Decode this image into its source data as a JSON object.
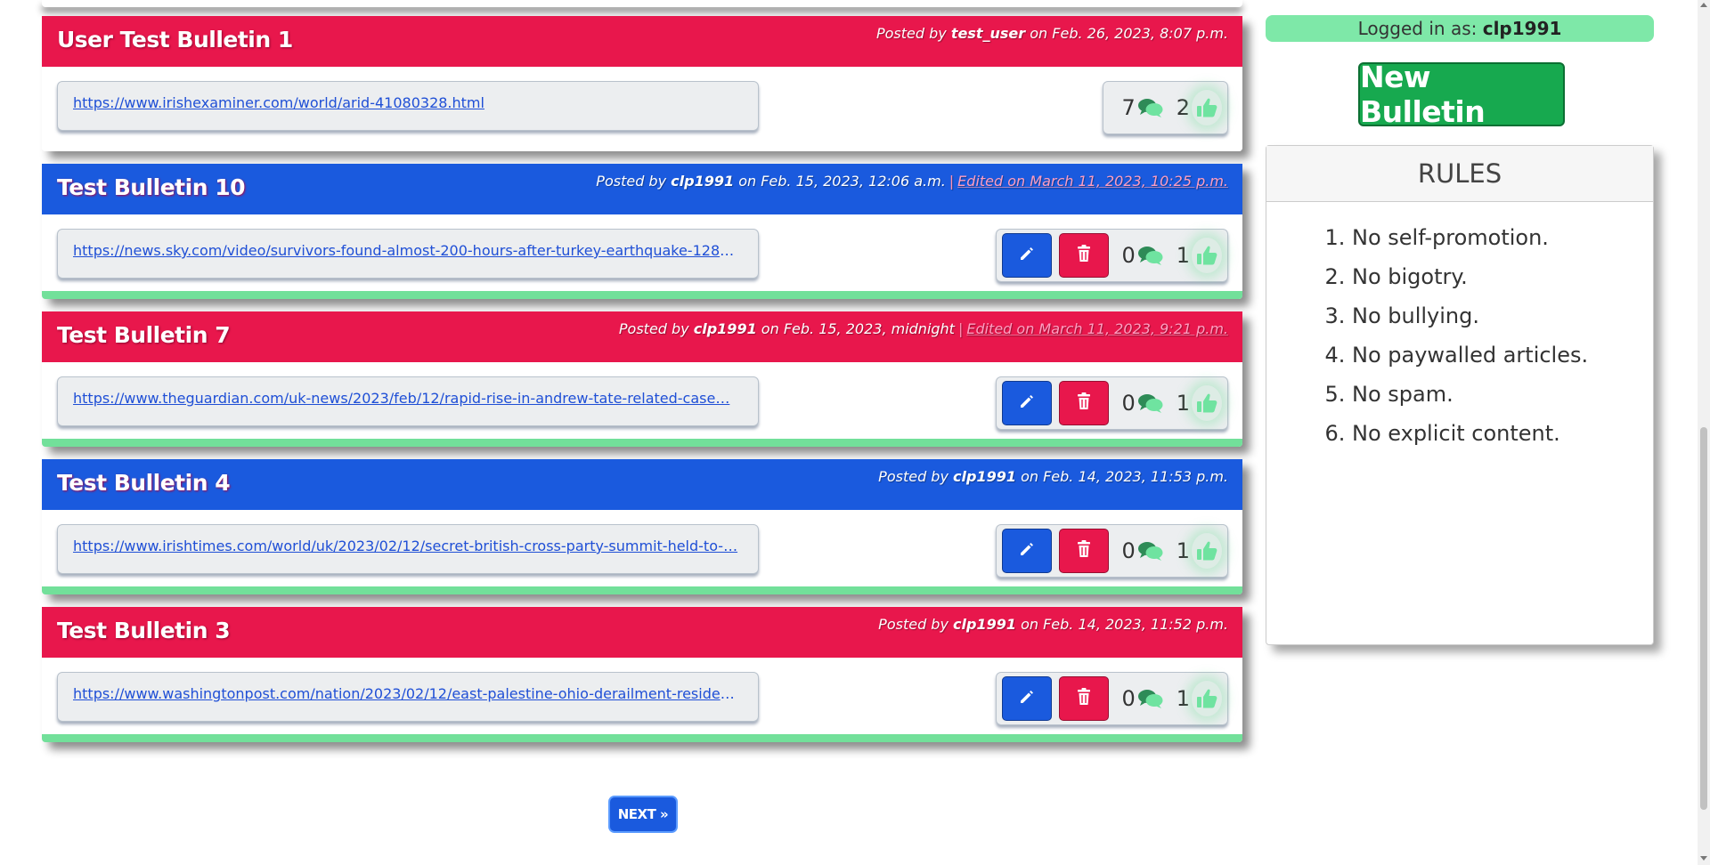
{
  "bulletins": [
    {
      "title": "User Test Bulletin 1",
      "posted_prefix": "Posted by",
      "author": "test_user",
      "date_text": "on Feb. 26, 2023, 8:07 p.m.",
      "edited_text": "",
      "url": "https://www.irishexaminer.com/world/arid-41080328.html",
      "comments": "7",
      "likes": "2",
      "color": "#e8174c",
      "owned": false
    },
    {
      "title": "Test Bulletin 10",
      "posted_prefix": "Posted by",
      "author": "clp1991",
      "date_text": "on Feb. 15, 2023, 12:06 a.m.",
      "edited_text": "Edited on March 11, 2023, 10:25 p.m.",
      "url": "https://news.sky.com/video/survivors-found-almost-200-hours-after-turkey-earthquake-1281…",
      "comments": "0",
      "likes": "1",
      "color": "#1a5ade",
      "owned": true
    },
    {
      "title": "Test Bulletin 7",
      "posted_prefix": "Posted by",
      "author": "clp1991",
      "date_text": "on Feb. 15, 2023, midnight",
      "edited_text": "Edited on March 11, 2023, 9:21 p.m.",
      "url": "https://www.theguardian.com/uk-news/2023/feb/12/rapid-rise-in-andrew-tate-related-case…",
      "comments": "0",
      "likes": "1",
      "color": "#e8174c",
      "owned": true
    },
    {
      "title": "Test Bulletin 4",
      "posted_prefix": "Posted by",
      "author": "clp1991",
      "date_text": "on Feb. 14, 2023, 11:53 p.m.",
      "edited_text": "",
      "url": "https://www.irishtimes.com/world/uk/2023/02/12/secret-british-cross-party-summit-held-to-…",
      "comments": "0",
      "likes": "1",
      "color": "#1a5ade",
      "owned": true
    },
    {
      "title": "Test Bulletin 3",
      "posted_prefix": "Posted by",
      "author": "clp1991",
      "date_text": "on Feb. 14, 2023, 11:52 p.m.",
      "edited_text": "",
      "url": "https://www.washingtonpost.com/nation/2023/02/12/east-palestine-ohio-derailment-residen…",
      "comments": "0",
      "likes": "1",
      "color": "#e8174c",
      "owned": true
    }
  ],
  "pagination": {
    "next_label": "NEXT »"
  },
  "sidebar": {
    "logged_prefix": "Logged in as:",
    "username": "clp1991",
    "new_bulletin_label": "New Bulletin",
    "rules_title": "RULES",
    "rules": [
      "No self-promotion.",
      "No bigotry.",
      "No bullying.",
      "No paywalled articles.",
      "No spam.",
      "No explicit content."
    ]
  },
  "icons": {
    "edit": "pencil-icon",
    "delete": "trash-icon",
    "comments": "comments-icon",
    "likes": "thumbs-up-icon"
  },
  "colors": {
    "red": "#e8174c",
    "blue": "#1a5ade",
    "green_accent": "#72e09a",
    "new_bulletin_green": "#17a94f"
  }
}
